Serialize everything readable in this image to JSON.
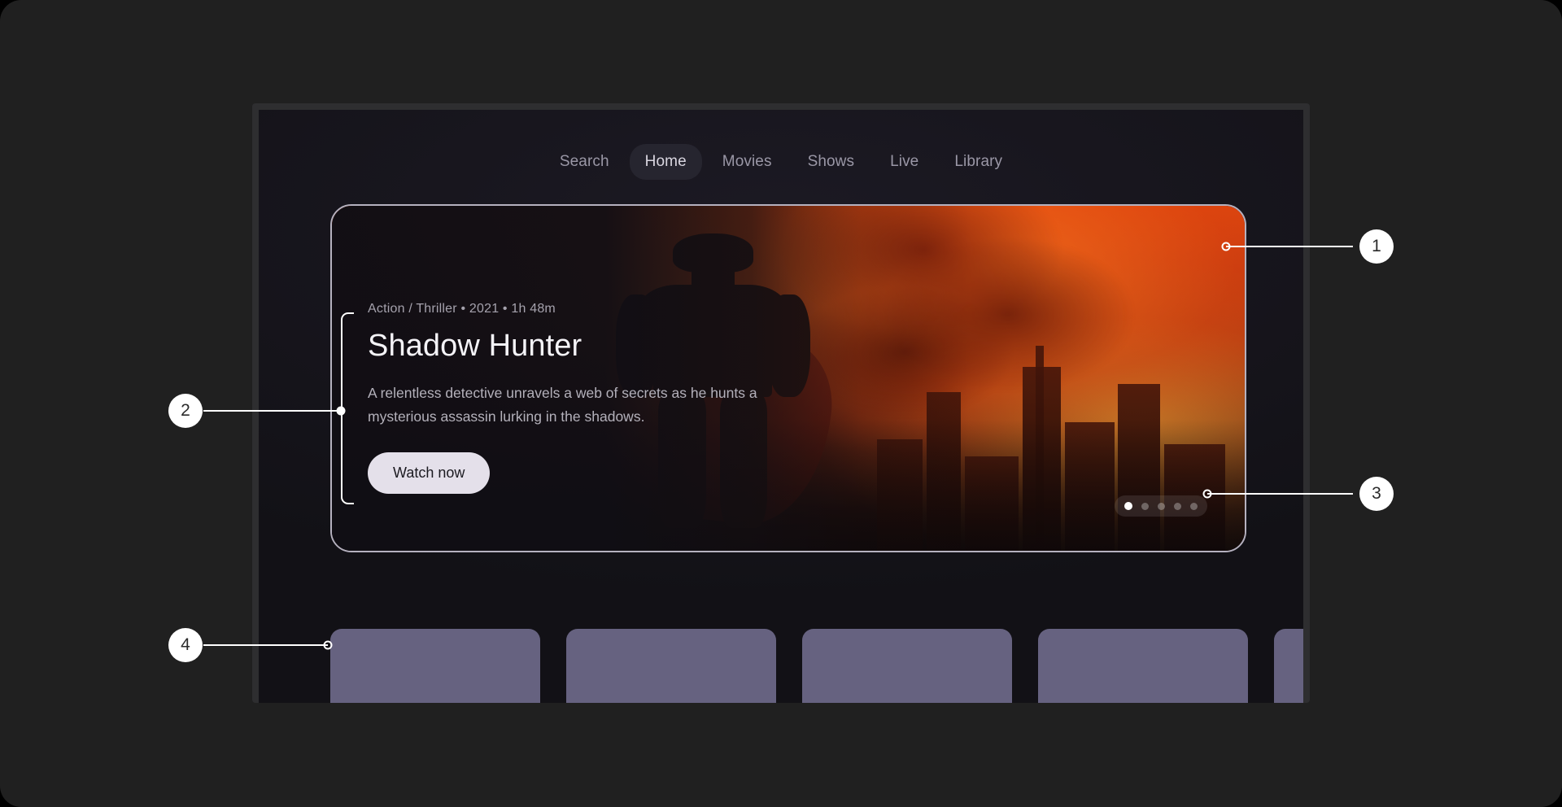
{
  "nav": {
    "items": [
      {
        "label": "Search",
        "active": false
      },
      {
        "label": "Home",
        "active": true
      },
      {
        "label": "Movies",
        "active": false
      },
      {
        "label": "Shows",
        "active": false
      },
      {
        "label": "Live",
        "active": false
      },
      {
        "label": "Library",
        "active": false
      }
    ]
  },
  "hero": {
    "meta": "Action / Thriller  •  2021  •  1h 48m",
    "title": "Shadow Hunter",
    "description": "A relentless detective unravels a web of secrets as he hunts a mysterious assassin lurking in the shadows.",
    "cta_label": "Watch now",
    "carousel": {
      "total": 5,
      "active_index": 0
    }
  },
  "card_row": {
    "count": 5,
    "cards": [
      {
        "id": "card-1"
      },
      {
        "id": "card-2"
      },
      {
        "id": "card-3"
      },
      {
        "id": "card-4"
      },
      {
        "id": "card-5"
      }
    ]
  },
  "annotations": [
    {
      "number": "1",
      "target": "hero-card-border"
    },
    {
      "number": "2",
      "target": "hero-text-block"
    },
    {
      "number": "3",
      "target": "carousel-dots"
    },
    {
      "number": "4",
      "target": "content-card-first"
    }
  ],
  "colors": {
    "page_background": "#202020",
    "device_frame": "#2e2e30",
    "screen_background": "#121116",
    "nav_active_pill": "#26252f",
    "nav_text": "#9a97a6",
    "nav_active_text": "#d9d6e0",
    "hero_border": "#b5b1bf",
    "cta_background": "#e4e0ea",
    "cta_text": "#1b1a20",
    "card_fill": "#666280",
    "annotation_white": "#ffffff",
    "annotation_number": "#2b2b2b",
    "hero_art_warm": "#d8440f"
  }
}
